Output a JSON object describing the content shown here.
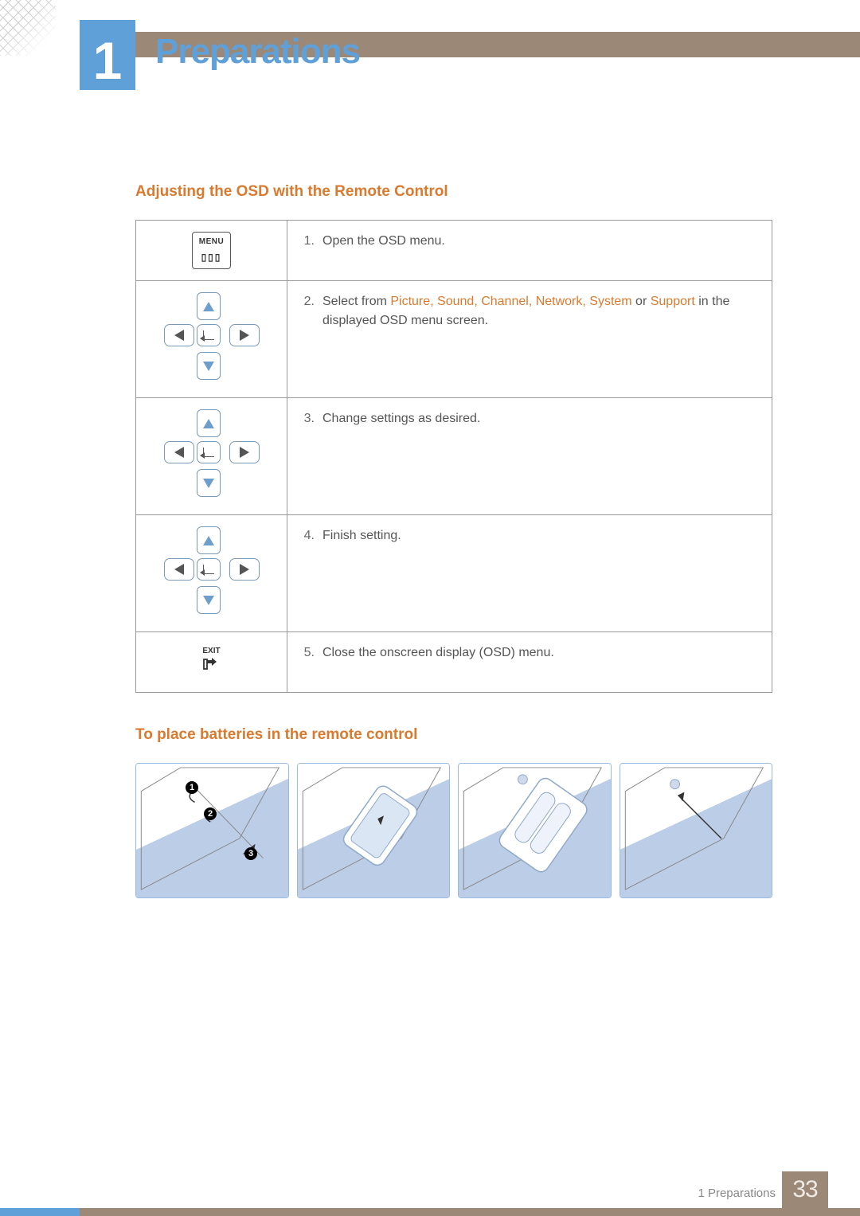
{
  "header": {
    "chapter_number": "1",
    "chapter_title": "Preparations"
  },
  "sections": {
    "adjusting": {
      "heading": "Adjusting the OSD with the Remote Control",
      "rows": [
        {
          "icon": "menu",
          "num": "1.",
          "text_plain": "Open the OSD menu.",
          "highlight_before": "",
          "highlight": "",
          "highlight_after": ""
        },
        {
          "icon": "dpad",
          "num": "2.",
          "text_plain": "Select from ",
          "highlight": "Picture, Sound, Channel, Network, System",
          "highlight_after": " or ",
          "highlight2": "Support",
          "after2": " in the displayed OSD menu screen."
        },
        {
          "icon": "dpad",
          "num": "3.",
          "text_plain": "Change settings as desired."
        },
        {
          "icon": "dpad",
          "num": "4.",
          "text_plain": "Finish setting."
        },
        {
          "icon": "exit",
          "num": "5.",
          "text_plain": "Close the onscreen display (OSD) menu."
        }
      ]
    },
    "batteries": {
      "heading": "To place batteries in the remote control",
      "callouts": [
        "1",
        "2",
        "3"
      ]
    }
  },
  "icons": {
    "menu_label": "MENU",
    "menu_slots": "▯▯▯",
    "exit_label": "EXIT"
  },
  "footer": {
    "section_ref": "1 Preparations",
    "page_number": "33"
  }
}
